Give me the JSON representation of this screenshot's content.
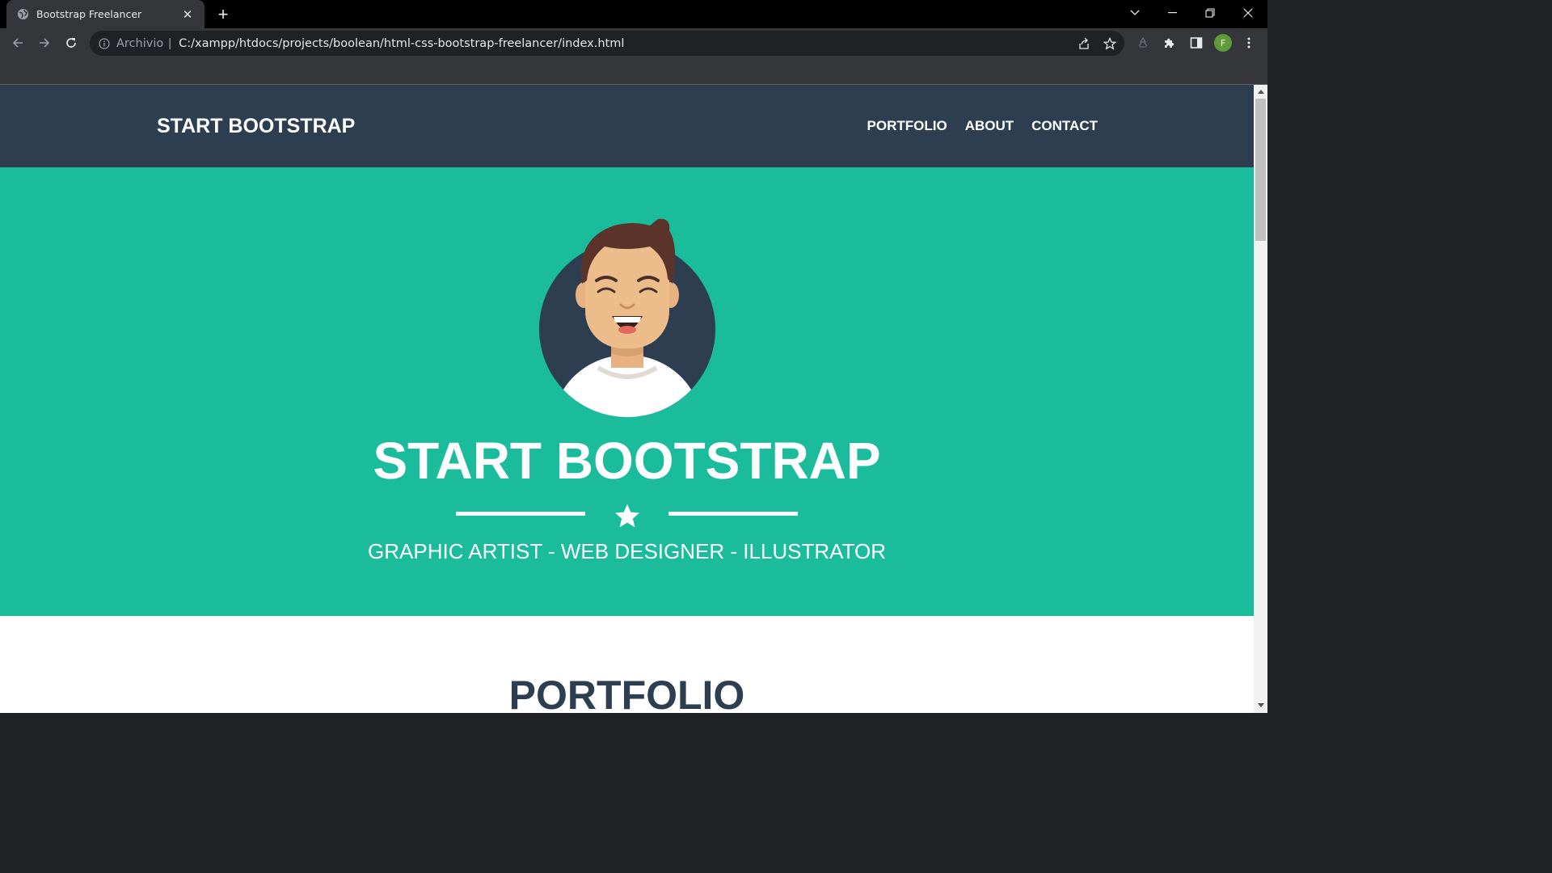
{
  "browser": {
    "tab_title": "Bootstrap Freelancer",
    "tab_close": "✕",
    "new_tab": "+",
    "omnibox_security_label": "Archivio",
    "omnibox_separator": "|",
    "url": "C:/xampp/htdocs/projects/boolean/html-css-bootstrap-freelancer/index.html",
    "profile_initial": "F"
  },
  "site": {
    "brand": "START BOOTSTRAP",
    "nav_links": [
      "PORTFOLIO",
      "ABOUT",
      "CONTACT"
    ],
    "hero_title": "START BOOTSTRAP",
    "hero_subtitle": "GRAPHIC ARTIST - WEB DESIGNER - ILLUSTRATOR",
    "portfolio_heading": "PORTFOLIO"
  },
  "colors": {
    "navbar": "#2c3e50",
    "hero": "#1abc9c",
    "heading_text": "#2c3e50"
  }
}
